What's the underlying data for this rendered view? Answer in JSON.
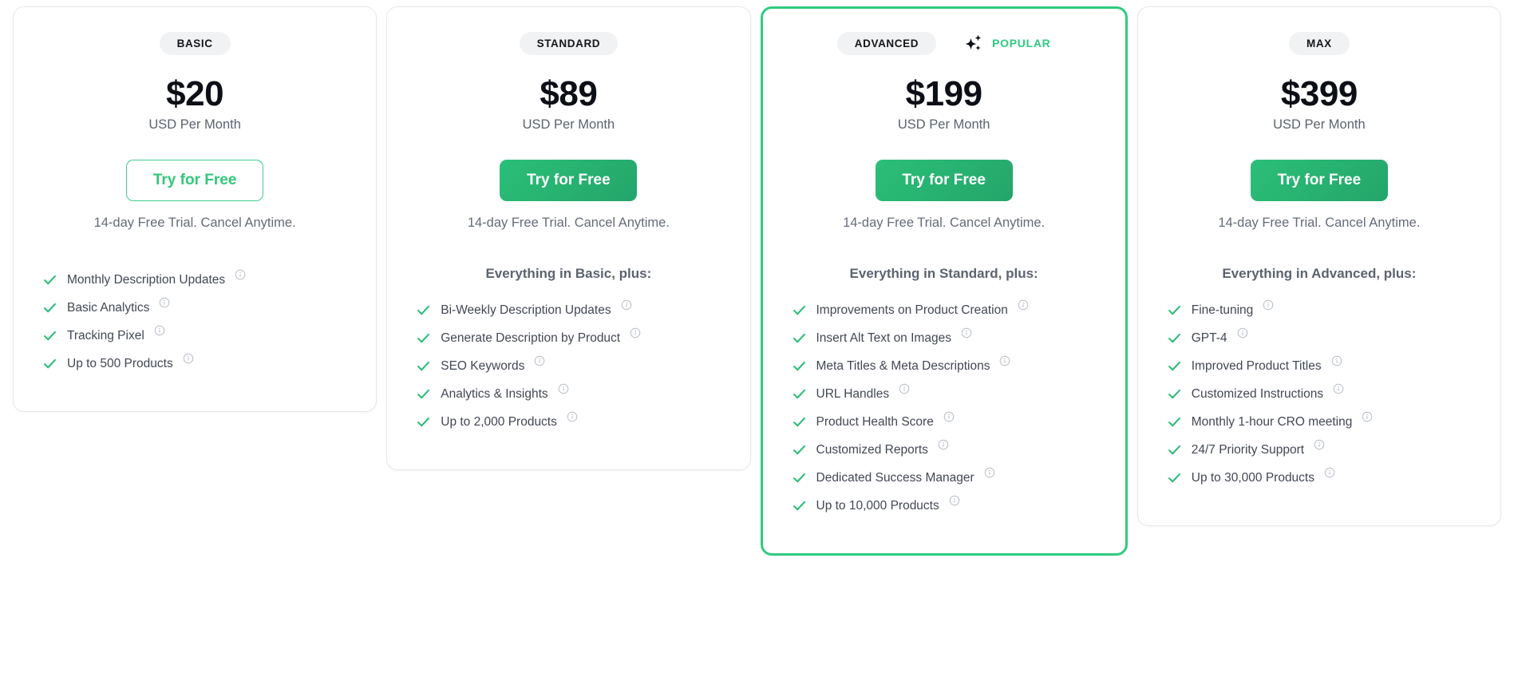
{
  "theme": {
    "accent_green": "#2ecc80",
    "check_green": "#2bbd7a",
    "text_dark": "#0d0f17",
    "text_muted": "#5b6270",
    "chip_bg": "#f1f2f3",
    "card_border": "#e7e7e8"
  },
  "icons": {
    "check": "check-icon",
    "info": "info-icon",
    "sparkle": "sparkle-icon"
  },
  "plans": [
    {
      "id": "basic",
      "name": "BASIC",
      "price": "$20",
      "period": "USD Per Month",
      "cta_label": "Try for Free",
      "cta_style": "outline",
      "trial_note": "14-day Free Trial. Cancel Anytime.",
      "featured": false,
      "popular_label": "",
      "everything_line": "",
      "features": [
        "Monthly Description Updates",
        "Basic Analytics",
        "Tracking Pixel",
        "Up to 500 Products"
      ]
    },
    {
      "id": "standard",
      "name": "STANDARD",
      "price": "$89",
      "period": "USD Per Month",
      "cta_label": "Try for Free",
      "cta_style": "solid",
      "trial_note": "14-day Free Trial. Cancel Anytime.",
      "featured": false,
      "popular_label": "",
      "everything_line": "Everything in Basic, plus:",
      "features": [
        "Bi-Weekly Description Updates",
        "Generate Description by Product",
        "SEO Keywords",
        "Analytics & Insights",
        "Up to 2,000 Products"
      ]
    },
    {
      "id": "advanced",
      "name": "ADVANCED",
      "price": "$199",
      "period": "USD Per Month",
      "cta_label": "Try for Free",
      "cta_style": "solid",
      "trial_note": "14-day Free Trial. Cancel Anytime.",
      "featured": true,
      "popular_label": "POPULAR",
      "everything_line": "Everything in Standard, plus:",
      "features": [
        "Improvements on Product Creation",
        "Insert Alt Text on Images",
        "Meta Titles & Meta Descriptions",
        "URL Handles",
        "Product Health Score",
        "Customized Reports",
        "Dedicated Success Manager",
        "Up to 10,000 Products"
      ]
    },
    {
      "id": "max",
      "name": "MAX",
      "price": "$399",
      "period": "USD Per Month",
      "cta_label": "Try for Free",
      "cta_style": "solid",
      "trial_note": "14-day Free Trial. Cancel Anytime.",
      "featured": false,
      "popular_label": "",
      "everything_line": "Everything in Advanced, plus:",
      "features": [
        "Fine-tuning",
        "GPT-4",
        "Improved Product Titles",
        "Customized Instructions",
        "Monthly 1-hour CRO meeting",
        "24/7 Priority Support",
        "Up to 30,000 Products"
      ]
    }
  ]
}
